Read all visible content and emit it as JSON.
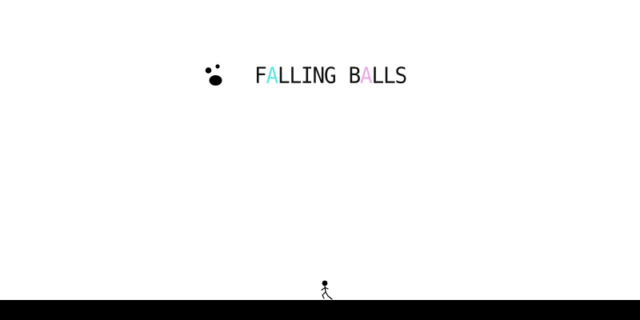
{
  "game": {
    "title_words": [
      {
        "letters": [
          {
            "char": "F",
            "color": "#111111"
          },
          {
            "char": "A",
            "color": "#5de6e6"
          },
          {
            "char": "L",
            "color": "#111111"
          },
          {
            "char": "L",
            "color": "#111111"
          },
          {
            "char": "I",
            "color": "#111111"
          },
          {
            "char": "N",
            "color": "#111111"
          },
          {
            "char": "G",
            "color": "#111111"
          }
        ]
      },
      {
        "letters": [
          {
            "char": "B",
            "color": "#111111"
          },
          {
            "char": "A",
            "color": "#f0a8e6"
          },
          {
            "char": "L",
            "color": "#111111"
          },
          {
            "char": "L",
            "color": "#111111"
          },
          {
            "char": "S",
            "color": "#111111"
          }
        ]
      }
    ],
    "logo_icon": "falling-balls-icon",
    "player_icon": "running-stick-figure-icon",
    "colors": {
      "background": "#ffffff",
      "ground": "#000000",
      "text": "#111111",
      "accent_cyan": "#5de6e6",
      "accent_pink": "#f0a8e6"
    }
  }
}
